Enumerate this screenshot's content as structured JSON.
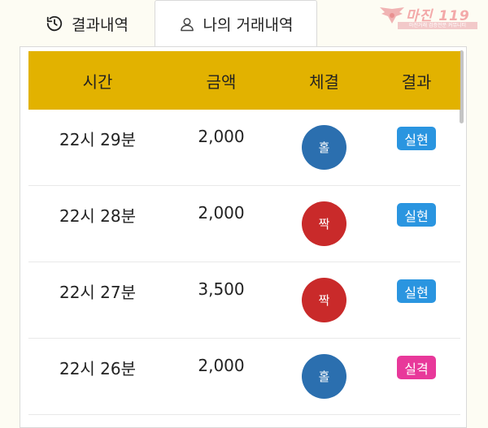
{
  "tabs": [
    {
      "label": "결과내역",
      "icon": "history-icon",
      "active": false
    },
    {
      "label": "나의 거래내역",
      "icon": "user-icon",
      "active": true
    }
  ],
  "watermark": {
    "brand": "마진 119",
    "tagline": "마진거래 검증전문 커뮤니티"
  },
  "colors": {
    "header": "#e2b200",
    "odd": "#2b6faf",
    "even": "#c92a2a",
    "win": "#2a95e0",
    "lose": "#e8389a"
  },
  "table": {
    "headers": [
      "시간",
      "금액",
      "체결",
      "결과"
    ],
    "rows": [
      {
        "time": "22시 29분",
        "amount": "2,000",
        "pick": "홀",
        "pick_type": "odd",
        "result": "실현",
        "result_type": "win"
      },
      {
        "time": "22시 28분",
        "amount": "2,000",
        "pick": "짝",
        "pick_type": "even",
        "result": "실현",
        "result_type": "win"
      },
      {
        "time": "22시 27분",
        "amount": "3,500",
        "pick": "짝",
        "pick_type": "even",
        "result": "실현",
        "result_type": "win"
      },
      {
        "time": "22시 26분",
        "amount": "2,000",
        "pick": "홀",
        "pick_type": "odd",
        "result": "실격",
        "result_type": "lose"
      }
    ]
  }
}
